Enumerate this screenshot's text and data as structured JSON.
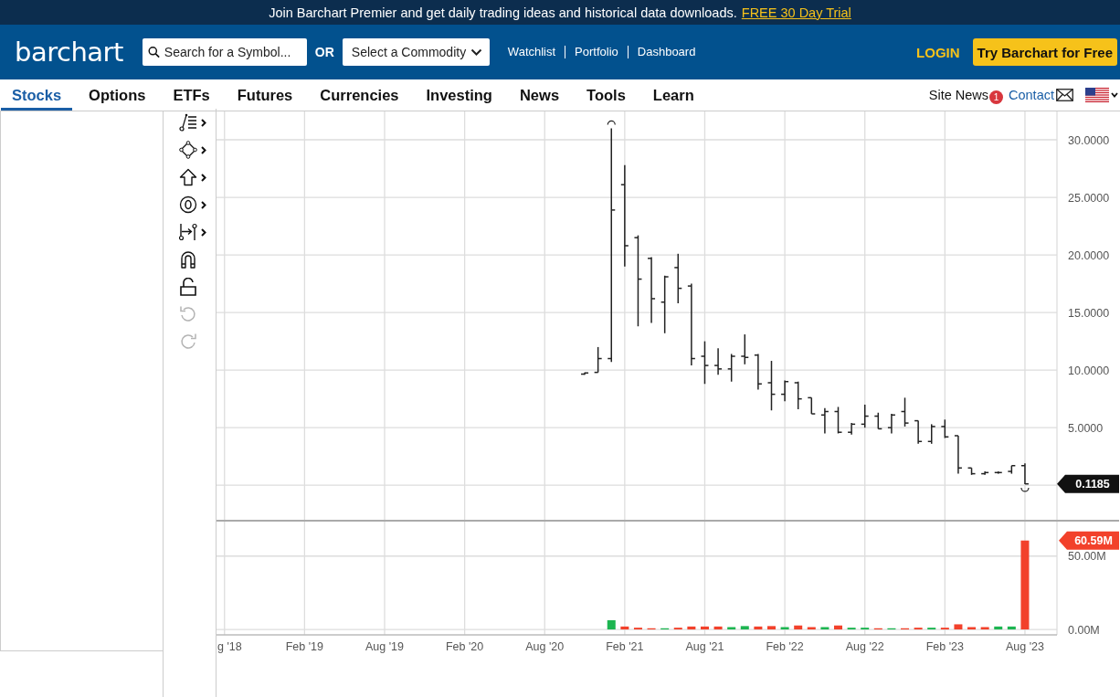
{
  "banner": {
    "text": "Join Barchart Premier and get daily trading ideas and historical data downloads.",
    "link": "FREE 30 Day Trial"
  },
  "header": {
    "logo": "barchart",
    "search": {
      "placeholder": "Search for a Symbol..."
    },
    "or_label": "OR",
    "commodity_select": {
      "value": "Select a Commodity"
    },
    "links": [
      "Watchlist",
      "Portfolio",
      "Dashboard"
    ],
    "login": "LOGIN",
    "cta": "Try Barchart for Free"
  },
  "nav": {
    "tabs": [
      {
        "label": "Stocks",
        "selected": true
      },
      {
        "label": "Options",
        "selected": false
      },
      {
        "label": "ETFs",
        "selected": false
      },
      {
        "label": "Futures",
        "selected": false
      },
      {
        "label": "Currencies",
        "selected": false
      },
      {
        "label": "Investing",
        "selected": false
      },
      {
        "label": "News",
        "selected": false
      },
      {
        "label": "Tools",
        "selected": false
      },
      {
        "label": "Learn",
        "selected": false
      }
    ],
    "site_news": {
      "label": "Site News",
      "badge": "1"
    },
    "contact": "Contact"
  },
  "toolbar": {
    "tools": [
      {
        "submenu": true,
        "disabled": false
      },
      {
        "submenu": true,
        "disabled": false
      },
      {
        "submenu": true,
        "disabled": false
      },
      {
        "submenu": true,
        "disabled": false
      },
      {
        "submenu": true,
        "disabled": false
      },
      {
        "submenu": false,
        "disabled": false
      },
      {
        "submenu": false,
        "disabled": false
      },
      {
        "submenu": false,
        "disabled": true
      },
      {
        "submenu": false,
        "disabled": true
      }
    ]
  },
  "price_chart": {
    "y_axis_labels": [
      "30.0000",
      "25.0000",
      "20.0000",
      "15.0000",
      "10.0000",
      "5.0000"
    ],
    "last_price": "0.1185"
  },
  "volume_chart": {
    "last_volume": "60.59M",
    "chart_data": {
      "type": "bar",
      "categories": [
        "g '18",
        null,
        null,
        null,
        null,
        null,
        "Feb '19",
        null,
        null,
        null,
        null,
        null,
        "Aug '19",
        null,
        null,
        null,
        null,
        null,
        "Feb '20",
        null,
        null,
        null,
        null,
        null,
        "Aug '20",
        null,
        null,
        null,
        null,
        null,
        "Feb '21",
        null,
        null,
        null,
        null,
        null,
        "Aug '21",
        null,
        null,
        null,
        null,
        null,
        "Feb '22",
        null,
        null,
        null,
        null,
        null,
        "Aug '22",
        null,
        null,
        null,
        null,
        null,
        "Feb '23",
        null,
        null,
        null,
        null,
        null,
        "Aug '23"
      ],
      "series": [
        {
          "color": "#1db551",
          "values": [
            null,
            null,
            null,
            null,
            null,
            null,
            null,
            null,
            null,
            null,
            null,
            null,
            null,
            null,
            null,
            null,
            null,
            null,
            null,
            null,
            null,
            null,
            null,
            null,
            null,
            null,
            null,
            null,
            null,
            6.3,
            null,
            null,
            null,
            0.8,
            null,
            null,
            null,
            null,
            1.6,
            2.3,
            null,
            null,
            1.6,
            null,
            null,
            1.6,
            null,
            1.2,
            1.2,
            null,
            0.8,
            null,
            null,
            1.2,
            null,
            null,
            null,
            null,
            2.0,
            2.0,
            null
          ]
        },
        {
          "color": "#f2412b",
          "values": [
            null,
            null,
            null,
            null,
            null,
            null,
            null,
            null,
            null,
            null,
            null,
            null,
            null,
            null,
            null,
            null,
            null,
            null,
            null,
            null,
            null,
            null,
            null,
            null,
            null,
            null,
            null,
            null,
            null,
            null,
            2.0,
            1.2,
            0.8,
            null,
            1.2,
            2.0,
            2.0,
            2.0,
            null,
            null,
            2.0,
            2.3,
            null,
            2.7,
            1.6,
            null,
            2.7,
            null,
            null,
            0.8,
            null,
            0.8,
            1.2,
            null,
            1.2,
            3.5,
            1.6,
            1.6,
            null,
            null,
            60.6
          ]
        }
      ],
      "grid": true,
      "ylim": [
        -3.7,
        73.5
      ],
      "yticks": [
        {
          "value": 0,
          "label": "0.00M"
        },
        {
          "value": 50,
          "label": "50.00M"
        }
      ]
    }
  }
}
